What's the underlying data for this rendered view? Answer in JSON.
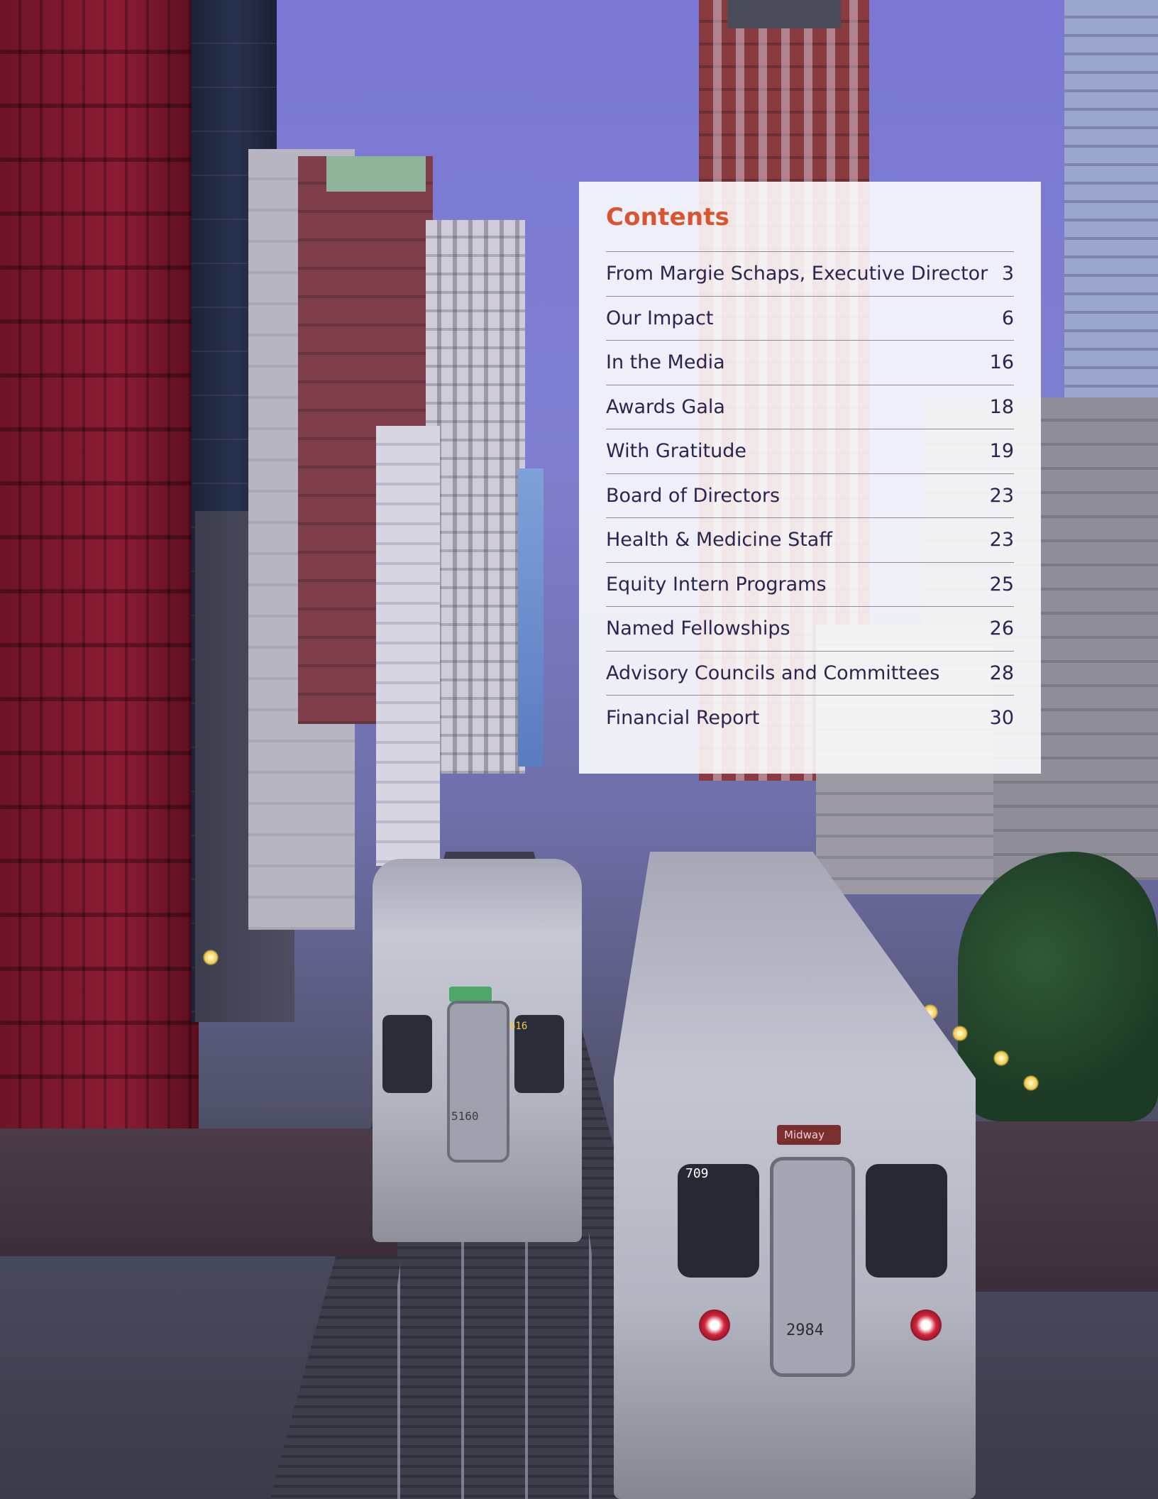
{
  "contents": {
    "title": "Contents",
    "accent_color": "#d9552f",
    "text_color": "#2b2550",
    "items": [
      {
        "label": "From Margie Schaps, Executive Director",
        "page": "3"
      },
      {
        "label": "Our Impact",
        "page": "6"
      },
      {
        "label": "In the Media",
        "page": "16"
      },
      {
        "label": "Awards Gala",
        "page": "18"
      },
      {
        "label": "With Gratitude",
        "page": "19"
      },
      {
        "label": "Board of Directors",
        "page": "23"
      },
      {
        "label": "Health & Medicine Staff",
        "page": "23"
      },
      {
        "label": "Equity Intern Programs",
        "page": "25"
      },
      {
        "label": "Named Fellowships",
        "page": "26"
      },
      {
        "label": "Advisory Councils and Committees",
        "page": "28"
      },
      {
        "label": "Financial Report",
        "page": "30"
      }
    ]
  },
  "background": {
    "train_left_number": "5160",
    "train_left_route_sign": "616",
    "train_right_number": "2984",
    "train_right_run_number": "709",
    "train_right_destination": "Midway"
  }
}
